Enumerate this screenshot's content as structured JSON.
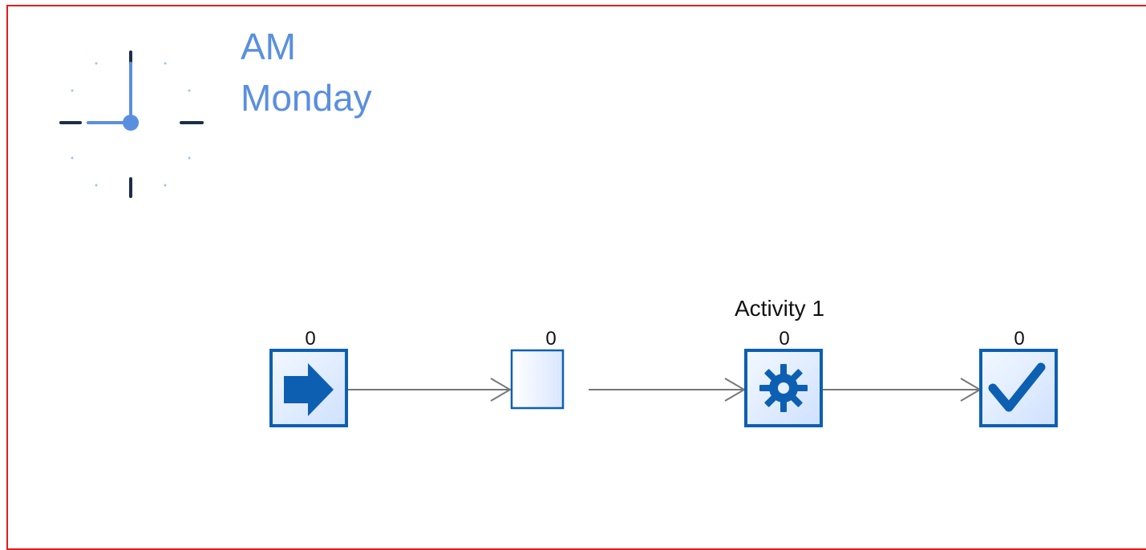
{
  "clock": {
    "ampm": "AM",
    "day": "Monday"
  },
  "diagram": {
    "start": {
      "count": "0"
    },
    "queue": {
      "count": "0"
    },
    "activity": {
      "label": "Activity 1",
      "count": "0"
    },
    "end": {
      "count": "0"
    }
  },
  "colors": {
    "accent": "#5a8fe0",
    "frame": "#e21b1b",
    "node_blue": "#0d5fb2",
    "node_fill": "#dbe9ff",
    "connector": "#777777"
  },
  "icons": {
    "start": "arrow-right-icon",
    "activity": "gear-icon",
    "end": "checkmark-icon"
  }
}
